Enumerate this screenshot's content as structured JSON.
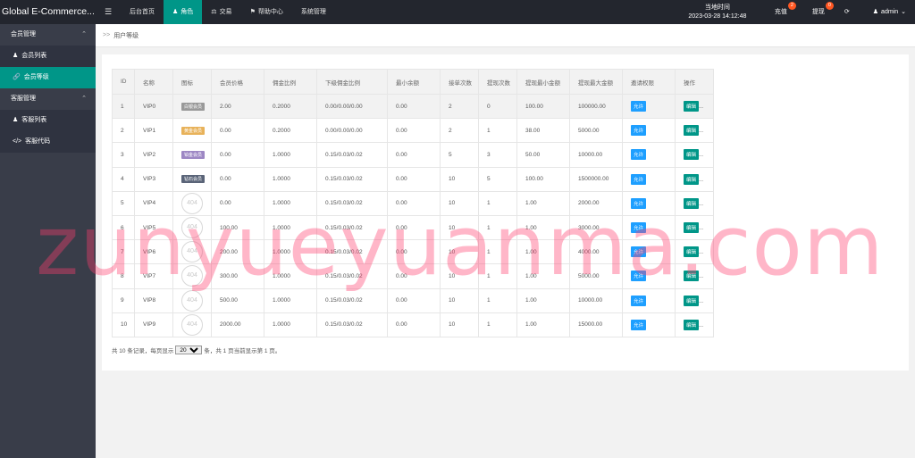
{
  "app": {
    "title": "Global E-Commerce..."
  },
  "topnav": {
    "items": [
      {
        "label": "后台首页"
      },
      {
        "label": "角色"
      },
      {
        "label": "交易"
      },
      {
        "label": "帮助中心"
      },
      {
        "label": "系统管理"
      }
    ],
    "clock_label": "当地时间",
    "clock_time": "2023-03-28 14:12:48",
    "recharge": {
      "label": "充值",
      "badge": "2"
    },
    "withdraw": {
      "label": "提现",
      "badge": "0"
    },
    "user": "admin"
  },
  "sidebar": {
    "groups": [
      {
        "label": "会员管理",
        "items": [
          {
            "label": "会员列表"
          },
          {
            "label": "会员等级"
          }
        ]
      },
      {
        "label": "客服管理",
        "items": [
          {
            "label": "客服列表"
          },
          {
            "label": "客服代码"
          }
        ]
      }
    ]
  },
  "breadcrumb": {
    "sep": ">>",
    "current": "用户等级"
  },
  "table": {
    "headers": [
      "ID",
      "名称",
      "图标",
      "会员价格",
      "佣金比例",
      "下级佣金比例",
      "最小余额",
      "接单次数",
      "提现次数",
      "提现最小金额",
      "提现最大金额",
      "邀请权限",
      "操作"
    ],
    "rows": [
      {
        "id": "1",
        "name": "VIP0",
        "icon": "白银会员",
        "price": "2.00",
        "rate": "0.2000",
        "sub_rate": "0.00/0.00/0.00",
        "min_balance": "0.00",
        "orders": "2",
        "withdraws": "0",
        "wd_min": "100.00",
        "wd_max": "100000.00"
      },
      {
        "id": "2",
        "name": "VIP1",
        "icon": "黄金会员",
        "price": "0.00",
        "rate": "0.2000",
        "sub_rate": "0.00/0.00/0.00",
        "min_balance": "0.00",
        "orders": "2",
        "withdraws": "1",
        "wd_min": "38.00",
        "wd_max": "5000.00"
      },
      {
        "id": "3",
        "name": "VIP2",
        "icon": "铂金会员",
        "price": "0.00",
        "rate": "1.0000",
        "sub_rate": "0.15/0.03/0.02",
        "min_balance": "0.00",
        "orders": "5",
        "withdraws": "3",
        "wd_min": "50.00",
        "wd_max": "10000.00"
      },
      {
        "id": "4",
        "name": "VIP3",
        "icon": "钻石会员",
        "price": "0.00",
        "rate": "1.0000",
        "sub_rate": "0.15/0.03/0.02",
        "min_balance": "0.00",
        "orders": "10",
        "withdraws": "5",
        "wd_min": "100.00",
        "wd_max": "1500000.00"
      },
      {
        "id": "5",
        "name": "VIP4",
        "icon": "404",
        "price": "0.00",
        "rate": "1.0000",
        "sub_rate": "0.15/0.03/0.02",
        "min_balance": "0.00",
        "orders": "10",
        "withdraws": "1",
        "wd_min": "1.00",
        "wd_max": "2000.00"
      },
      {
        "id": "6",
        "name": "VIP5",
        "icon": "404",
        "price": "100.00",
        "rate": "1.0000",
        "sub_rate": "0.15/0.03/0.02",
        "min_balance": "0.00",
        "orders": "10",
        "withdraws": "1",
        "wd_min": "1.00",
        "wd_max": "3000.00"
      },
      {
        "id": "7",
        "name": "VIP6",
        "icon": "404",
        "price": "200.00",
        "rate": "1.0000",
        "sub_rate": "0.15/0.03/0.02",
        "min_balance": "0.00",
        "orders": "10",
        "withdraws": "1",
        "wd_min": "1.00",
        "wd_max": "4000.00"
      },
      {
        "id": "8",
        "name": "VIP7",
        "icon": "404",
        "price": "300.00",
        "rate": "1.0000",
        "sub_rate": "0.15/0.03/0.02",
        "min_balance": "0.00",
        "orders": "10",
        "withdraws": "1",
        "wd_min": "1.00",
        "wd_max": "5000.00"
      },
      {
        "id": "9",
        "name": "VIP8",
        "icon": "404",
        "price": "500.00",
        "rate": "1.0000",
        "sub_rate": "0.15/0.03/0.02",
        "min_balance": "0.00",
        "orders": "10",
        "withdraws": "1",
        "wd_min": "1.00",
        "wd_max": "10000.00"
      },
      {
        "id": "10",
        "name": "VIP9",
        "icon": "404",
        "price": "2000.00",
        "rate": "1.0000",
        "sub_rate": "0.15/0.03/0.02",
        "min_balance": "0.00",
        "orders": "10",
        "withdraws": "1",
        "wd_min": "1.00",
        "wd_max": "15000.00"
      }
    ],
    "allow_label": "允许",
    "edit_label": "编辑",
    "more_label": "..."
  },
  "pager": {
    "prefix": "共 10 条记录，每页显示",
    "page_size": "20",
    "suffix": "条，共 1 页当前显示第 1 页。"
  },
  "watermark": "zunyueyuanma.com",
  "colors": {
    "accent": "#009688",
    "topbar": "#23262e",
    "sidebar": "#393d49",
    "allow": "#1e9fff",
    "badge": "#ff5722"
  }
}
